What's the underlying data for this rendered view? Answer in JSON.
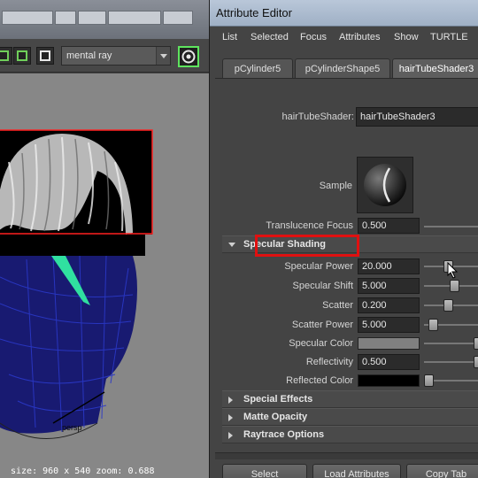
{
  "viewport": {
    "renderer": "mental ray",
    "status": "size: 960 x 540  zoom: 0.688",
    "camera": "persp"
  },
  "attribute_editor": {
    "title": "Attribute Editor",
    "menu": [
      "List",
      "Selected",
      "Focus",
      "Attributes",
      "Show",
      "TURTLE"
    ],
    "tabs": [
      "pCylinder5",
      "pCylinderShape5",
      "hairTubeShader3"
    ],
    "active_tab": "hairTubeShader3",
    "shader_label": "hairTubeShader:",
    "shader_name": "hairTubeShader3",
    "sample_label": "Sample",
    "translucence_focus": {
      "label": "Translucence Focus",
      "value": "0.500"
    },
    "specular_section": "Specular Shading",
    "specular_attrs": {
      "specular_power": {
        "label": "Specular Power",
        "value": "20.000",
        "level": 0.4
      },
      "specular_shift": {
        "label": "Specular Shift",
        "value": "5.000",
        "level": 0.55
      },
      "scatter": {
        "label": "Scatter",
        "value": "0.200",
        "level": 0.2
      },
      "scatter_power": {
        "label": "Scatter Power",
        "value": "5.000",
        "level": 0.1
      },
      "specular_color": {
        "label": "Specular Color",
        "color": "#808080"
      },
      "reflectivity": {
        "label": "Reflectivity",
        "value": "0.500"
      },
      "reflected_color": {
        "label": "Reflected Color",
        "color": "#000000"
      }
    },
    "collapsed_sections": [
      "Special Effects",
      "Matte Opacity",
      "Raytrace Options"
    ],
    "buttons": {
      "select": "Select",
      "load": "Load Attributes",
      "copy": "Copy Tab"
    }
  }
}
